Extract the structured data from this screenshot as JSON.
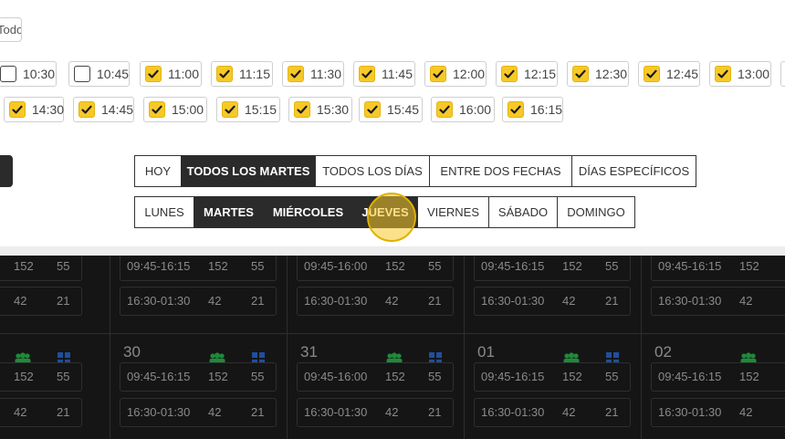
{
  "filter": {
    "todo_label": "Todo",
    "times": [
      {
        "label": "10:30",
        "checked": false
      },
      {
        "label": "10:45",
        "checked": false
      },
      {
        "label": "11:00",
        "checked": true
      },
      {
        "label": "11:15",
        "checked": true
      },
      {
        "label": "11:30",
        "checked": true
      },
      {
        "label": "11:45",
        "checked": true
      },
      {
        "label": "12:00",
        "checked": true
      },
      {
        "label": "12:15",
        "checked": true
      },
      {
        "label": "12:30",
        "checked": true
      },
      {
        "label": "12:45",
        "checked": true
      },
      {
        "label": "13:00",
        "checked": true
      },
      {
        "label": "14:30",
        "checked": true
      },
      {
        "label": "14:45",
        "checked": true
      },
      {
        "label": "15:00",
        "checked": true
      },
      {
        "label": "15:15",
        "checked": true
      },
      {
        "label": "15:30",
        "checked": true
      },
      {
        "label": "15:45",
        "checked": true
      },
      {
        "label": "16:00",
        "checked": true
      },
      {
        "label": "16:15",
        "checked": true
      }
    ],
    "modes": [
      {
        "label": "HOY",
        "active": false
      },
      {
        "label": "TODOS LOS MARTES",
        "active": true
      },
      {
        "label": "TODOS LOS DÍAS",
        "active": false
      },
      {
        "label": "ENTRE DOS FECHAS",
        "active": false
      },
      {
        "label": "DÍAS ESPECÍFICOS",
        "active": false
      }
    ],
    "weekdays": [
      {
        "label": "LUNES",
        "active": false
      },
      {
        "label": "MARTES",
        "active": true
      },
      {
        "label": "MIÉRCOLES",
        "active": true
      },
      {
        "label": "JUEVES",
        "active": true
      },
      {
        "label": "VIERNES",
        "active": false
      },
      {
        "label": "SÁBADO",
        "active": false
      },
      {
        "label": "DOMINGO",
        "active": false
      }
    ]
  },
  "calendar": {
    "colors": {
      "people_icon": "#1f8a3a",
      "grid_icon": "#1e4f9e",
      "checkbox": "#f7c928"
    },
    "rows": [
      {
        "cells": [
          {
            "day": "",
            "slots": [
              [
                "",
                "152",
                "55"
              ],
              [
                "",
                "42",
                "21"
              ]
            ]
          },
          {
            "day": "",
            "slots": [
              [
                "09:45-16:15",
                "152",
                "55"
              ],
              [
                "16:30-01:30",
                "42",
                "21"
              ]
            ]
          },
          {
            "day": "",
            "slots": [
              [
                "09:45-16:00",
                "152",
                "55"
              ],
              [
                "16:30-01:30",
                "42",
                "21"
              ]
            ]
          },
          {
            "day": "",
            "slots": [
              [
                "09:45-16:15",
                "152",
                "55"
              ],
              [
                "16:30-01:30",
                "42",
                "21"
              ]
            ]
          },
          {
            "day": "",
            "slots": [
              [
                "09:45-16:15",
                "152",
                ""
              ],
              [
                "16:30-01:30",
                "42",
                ""
              ]
            ]
          }
        ]
      },
      {
        "cells": [
          {
            "day": "",
            "slots": [
              [
                "",
                "152",
                "55"
              ],
              [
                "",
                "42",
                "21"
              ]
            ]
          },
          {
            "day": "30",
            "slots": [
              [
                "09:45-16:15",
                "152",
                "55"
              ],
              [
                "16:30-01:30",
                "42",
                "21"
              ]
            ]
          },
          {
            "day": "31",
            "slots": [
              [
                "09:45-16:00",
                "152",
                "55"
              ],
              [
                "16:30-01:30",
                "42",
                "21"
              ]
            ]
          },
          {
            "day": "01",
            "slots": [
              [
                "09:45-16:15",
                "152",
                "55"
              ],
              [
                "16:30-01:30",
                "42",
                "21"
              ]
            ]
          },
          {
            "day": "02",
            "slots": [
              [
                "09:45-16:15",
                "152",
                ""
              ],
              [
                "16:30-01:30",
                "42",
                ""
              ]
            ]
          }
        ]
      }
    ]
  }
}
